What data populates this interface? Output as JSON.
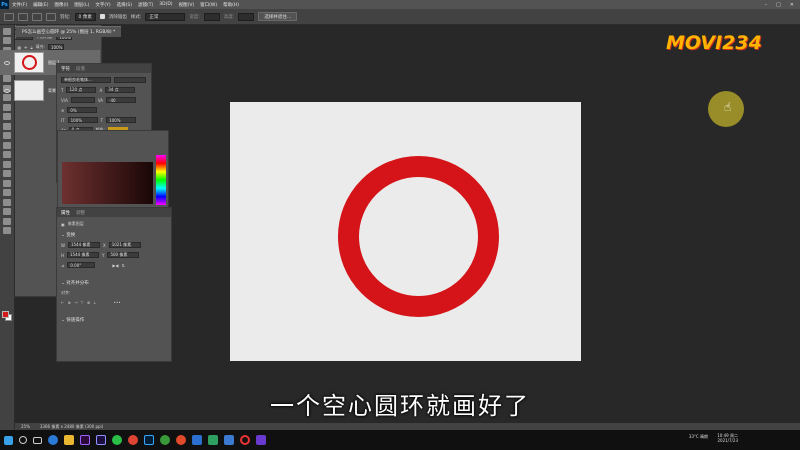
{
  "menubar": {
    "logo": "Ps",
    "items": [
      "文件(F)",
      "编辑(E)",
      "图像(I)",
      "图层(L)",
      "文字(Y)",
      "选择(S)",
      "滤镜(T)",
      "3D(D)",
      "视图(V)",
      "窗口(W)",
      "帮助(H)"
    ]
  },
  "optionsbar": {
    "feather_label": "羽化:",
    "feather_value": "0 像素",
    "antialias_label": "消除锯齿",
    "style_label": "样式:",
    "style_value": "正常",
    "width_label": "宽度:",
    "height_label": "高度:",
    "select_mask_button": "选择并遮住..."
  },
  "document": {
    "tab_title": "PS怎么画空心圆环 @ 25% (图层 1, RGB/8) *"
  },
  "character_panel": {
    "tabs": [
      "字符",
      "段落"
    ],
    "font_family": "单根良毛笔体...",
    "size": "120 点",
    "leading": "34 点",
    "tracking": "-40",
    "scale_percent": "0%",
    "vertical_scale": "100%",
    "horizontal_scale": "100%",
    "baseline": "0 点",
    "color_label": "颜色:",
    "typo_buttons": [
      "T",
      "T",
      "TT",
      "Tr",
      "T¹",
      "T₁",
      "T",
      "Ŧ"
    ],
    "language": "美国英语",
    "antialias": "平滑"
  },
  "properties_panel": {
    "tabs": [
      "属性",
      "调整"
    ],
    "layer_type": "像素图层",
    "transform_header": "变换",
    "w_label": "W",
    "w_value": "1544 像素",
    "x_value": "1021 像素",
    "h_label": "H",
    "h_value": "1544 像素",
    "y_value": "500 像素",
    "angle_value": "0.00°",
    "align_header": "对齐并分布",
    "align_label": "对齐:",
    "quick_actions_header": "快速操作"
  },
  "layers_panel": {
    "tabs": [
      "图层",
      "通道",
      "路径"
    ],
    "kind_label": "类型",
    "blend_mode": "正常",
    "opacity_label": "不透明度:",
    "opacity_value": "100%",
    "lock_label": "锁定:",
    "fill_label": "填充:",
    "fill_value": "100%",
    "layers": [
      {
        "name": "图层 1"
      },
      {
        "name": "背景"
      }
    ]
  },
  "subtitle": "一个空心圆环就画好了",
  "statusbar": {
    "zoom": "25%",
    "doc_size": "3366 像素 x 2480 像素 (300 ppi)"
  },
  "taskbar": {
    "weather_temp": "33°C",
    "weather_text": "晴朗",
    "time": "10:49 周二",
    "date": "2021/7/23"
  },
  "watermark": "MOVI234",
  "colors": {
    "ring": "#d41418",
    "canvas": "#ebebeb",
    "workspace": "#282828",
    "foreground_swatch": "#d41a1a"
  }
}
